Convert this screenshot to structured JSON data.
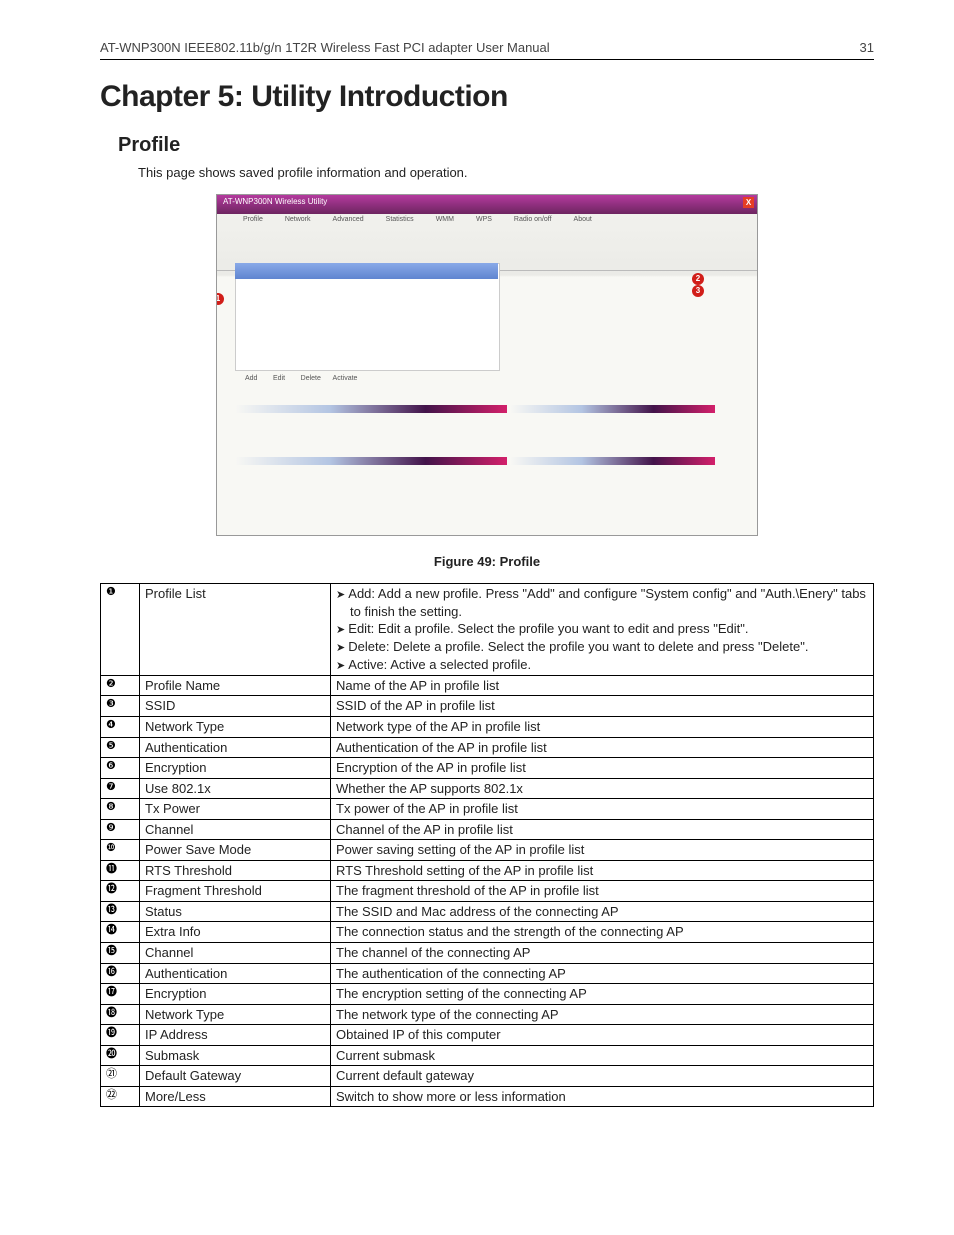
{
  "header": {
    "title": "AT-WNP300N IEEE802.11b/g/n 1T2R Wireless Fast PCI adapter User Manual",
    "page": "31"
  },
  "chapter": "Chapter 5: Utility Introduction",
  "section": "Profile",
  "intro": "This page shows saved profile information and operation.",
  "figure": {
    "caption": "Figure 49: Profile",
    "window_title": "AT-WNP300N Wireless Utility",
    "tabs": [
      "Profile",
      "Network",
      "Advanced",
      "Statistics",
      "WMM",
      "WPS",
      "Radio on/off",
      "About"
    ]
  },
  "rows": [
    {
      "n": "❶",
      "label": "Profile List",
      "desc_list": [
        "Add: Add a new profile. Press \"Add\" and configure \"System config\" and \"Auth.\\Enery\" tabs to finish the setting.",
        "Edit: Edit a profile. Select the profile you want to edit and press \"Edit\".",
        "Delete: Delete a profile. Select the profile you want to delete and press \"Delete\".",
        "Active: Active a selected profile."
      ]
    },
    {
      "n": "❷",
      "label": "Profile Name",
      "desc": "Name of the AP in profile list"
    },
    {
      "n": "❸",
      "label": "SSID",
      "desc": "SSID of the AP in profile list"
    },
    {
      "n": "❹",
      "label": "Network Type",
      "desc": "Network type of the AP in profile list"
    },
    {
      "n": "❺",
      "label": "Authentication",
      "desc": "Authentication of the AP in profile list"
    },
    {
      "n": "❻",
      "label": "Encryption",
      "desc": "Encryption of the AP in profile list"
    },
    {
      "n": "❼",
      "label": "Use 802.1x",
      "desc": "Whether the AP supports 802.1x"
    },
    {
      "n": "❽",
      "label": "Tx Power",
      "desc": "Tx power of the AP in profile list"
    },
    {
      "n": "❾",
      "label": "Channel",
      "desc": "Channel of the AP in profile list"
    },
    {
      "n": "❿",
      "label": "Power Save Mode",
      "desc": "Power saving setting of the AP in profile list"
    },
    {
      "n": "⓫",
      "label": "RTS Threshold",
      "desc": "RTS Threshold setting of the AP in profile list"
    },
    {
      "n": "⓬",
      "label": "Fragment Threshold",
      "desc": "The fragment threshold of the AP in profile list"
    },
    {
      "n": "⓭",
      "label": "Status",
      "desc": "The SSID and Mac address of the connecting AP"
    },
    {
      "n": "⓮",
      "label": "Extra Info",
      "desc": "The connection status and the strength of the connecting AP"
    },
    {
      "n": "⓯",
      "label": "Channel",
      "desc": "The channel of the connecting AP"
    },
    {
      "n": "⓰",
      "label": "Authentication",
      "desc": "The authentication of the connecting AP"
    },
    {
      "n": "⓱",
      "label": "Encryption",
      "desc": "The encryption setting of the connecting AP"
    },
    {
      "n": "⓲",
      "label": "Network Type",
      "desc": "The network type of the connecting AP"
    },
    {
      "n": "⓳",
      "label": "IP Address",
      "desc": "Obtained IP of this computer"
    },
    {
      "n": "⓴",
      "label": "Submask",
      "desc": "Current submask"
    },
    {
      "n": "㉑",
      "label": "Default Gateway",
      "desc": "Current default gateway"
    },
    {
      "n": "㉒",
      "label": "More/Less",
      "desc": "Switch to show more or less information"
    }
  ]
}
